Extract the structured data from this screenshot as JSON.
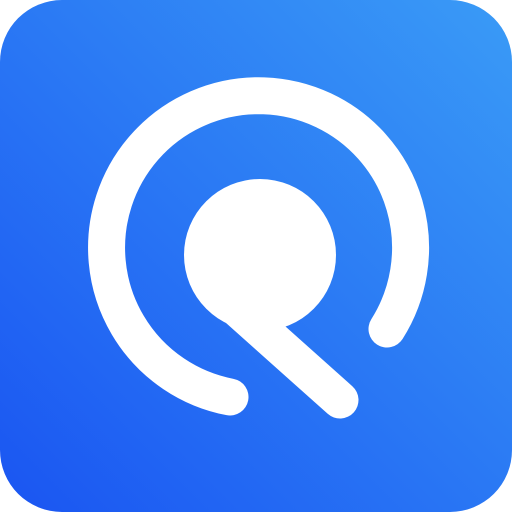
{
  "icon": {
    "name": "search-app-icon",
    "glyph": "magnifier-ring-icon",
    "colors": {
      "gradient_start": "#1a55f2",
      "gradient_end": "#3a9bf6",
      "glyph": "#ffffff"
    }
  }
}
